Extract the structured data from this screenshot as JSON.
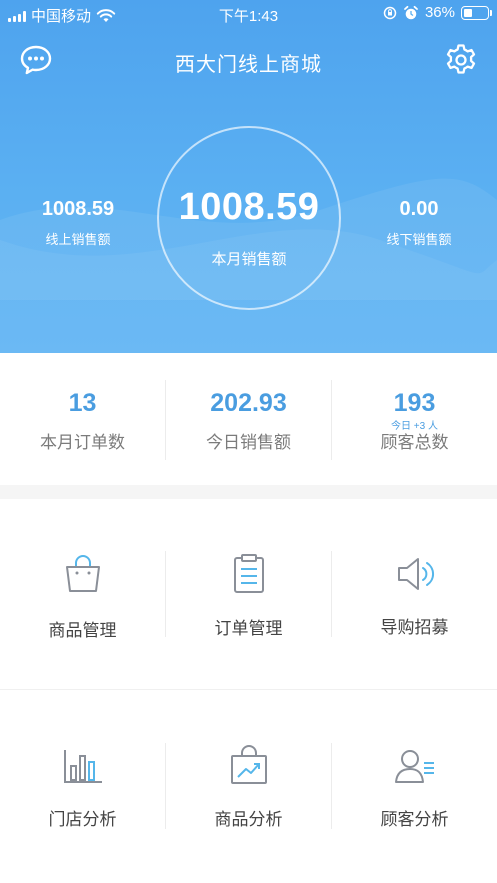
{
  "status_bar": {
    "carrier": "中国移动",
    "time": "下午1:43",
    "battery_percent": "36%",
    "battery_level": 0.36
  },
  "nav": {
    "title": "西大门线上商城",
    "left_icon": "chat-bubble-icon",
    "right_icon": "gear-icon"
  },
  "sales": {
    "monthly_total_value": "1008.59",
    "monthly_total_label": "本月销售额",
    "online_value": "1008.59",
    "online_label": "线上销售额",
    "offline_value": "0.00",
    "offline_label": "线下销售额"
  },
  "summary": [
    {
      "value": "13",
      "label": "本月订单数"
    },
    {
      "value": "202.93",
      "label": "今日销售额"
    },
    {
      "value": "193",
      "label": "顾客总数",
      "sub": "今日 +3 人"
    }
  ],
  "menu": [
    {
      "label": "商品管理",
      "icon": "shopping-bag-icon"
    },
    {
      "label": "订单管理",
      "icon": "clipboard-icon"
    },
    {
      "label": "导购招募",
      "icon": "speaker-icon"
    },
    {
      "label": "门店分析",
      "icon": "bar-chart-icon"
    },
    {
      "label": "商品分析",
      "icon": "trend-chart-icon"
    },
    {
      "label": "顾客分析",
      "icon": "user-list-icon"
    }
  ],
  "colors": {
    "header_blue": "#5bb0f2",
    "accent_blue": "#4a9de0",
    "icon_gray": "#8a8f98",
    "icon_accent": "#55b6ea"
  }
}
